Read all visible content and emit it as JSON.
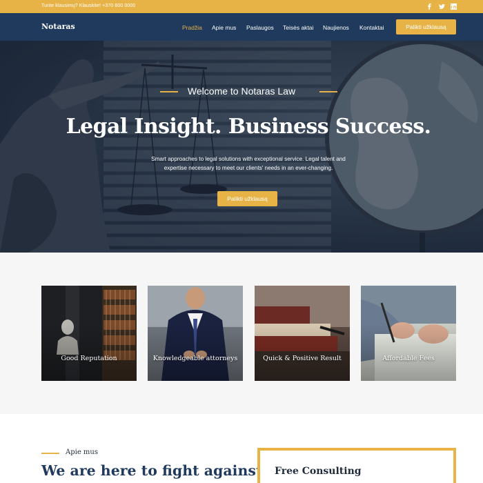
{
  "topbar": {
    "note": "Turite klausimų? Klauskite! +370 600 0000",
    "social": [
      "facebook-icon",
      "twitter-icon",
      "linkedin-icon"
    ]
  },
  "header": {
    "logo": "Notaras",
    "nav": [
      "Pradžia",
      "Apie mus",
      "Paslaugos",
      "Teisės aktai",
      "Naujienos",
      "Kontaktai"
    ],
    "active_nav": "Pradžia",
    "cta": "Palikti užklausą"
  },
  "hero": {
    "eyebrow": "Welcome to Notaras Law",
    "title": "Legal Insight. Business Success.",
    "subtitle_line1": "Smart approaches to legal solutions with exceptional service. Legal talent and",
    "subtitle_line2": "expertise necessary to meet our clients' needs in an ever-changing.",
    "button": "Palikti užklausą"
  },
  "features": [
    {
      "label": "Good Reputation"
    },
    {
      "label": "Knowledgeable attorneys"
    },
    {
      "label": "Quick & Positive Result"
    },
    {
      "label": "Affordable Fees"
    }
  ],
  "about": {
    "kicker": "Apie mus",
    "heading": "We are here to fight against"
  },
  "consulting": {
    "title": "Free Consulting"
  },
  "colors": {
    "accent": "#e7b347",
    "navy": "#1f3a5c",
    "features_bg": "#f6f6f6"
  }
}
